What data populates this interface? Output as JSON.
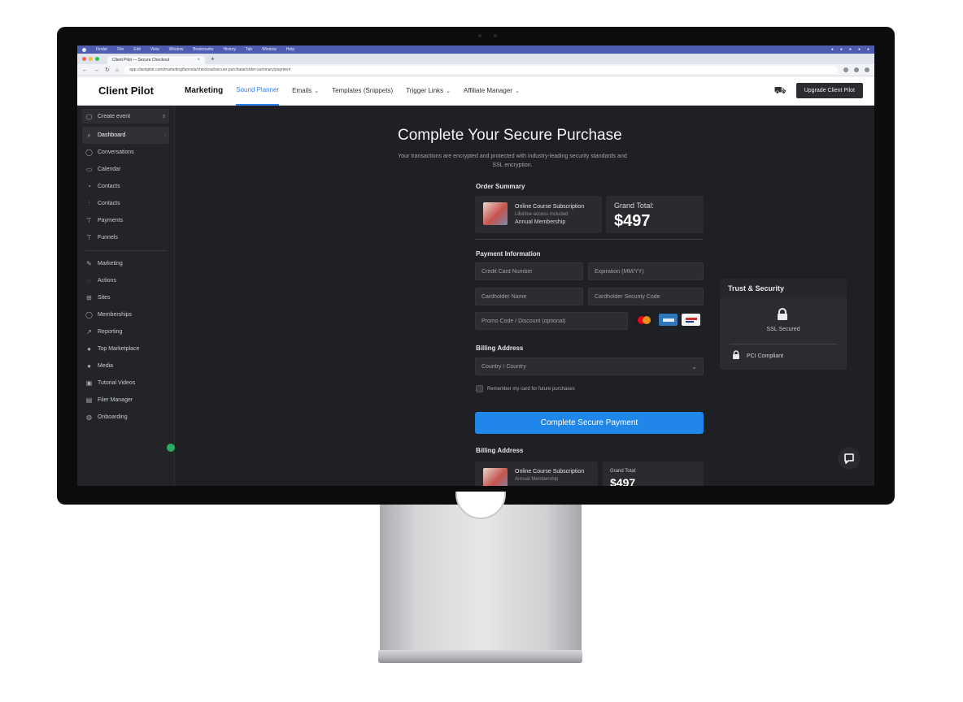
{
  "os_menu": {
    "items": [
      "Finder",
      "File",
      "Edit",
      "View",
      "Window",
      "Bookmarks",
      "History",
      "Tab",
      "Window",
      "Help"
    ]
  },
  "browser": {
    "tab_title": "Client Pilot — Secure Checkout",
    "url": "app.clientpilot.com/marketing/funnels/checkout/secure-purchase/order-summary/payment"
  },
  "app": {
    "logo": "Client Pilot",
    "nav": [
      {
        "label": "Marketing",
        "chevron": false
      },
      {
        "label": "Sound Planner",
        "chevron": false
      },
      {
        "label": "Emails",
        "chevron": true
      },
      {
        "label": "Templates (Snippets)",
        "chevron": false
      },
      {
        "label": "Trigger Links",
        "chevron": true
      },
      {
        "label": "Affiliate Manager",
        "chevron": true
      }
    ],
    "cta": "Upgrade Client Pilot"
  },
  "sidebar": {
    "switcher": "Create event",
    "items": [
      {
        "icon": "search-icon",
        "glyph": "⌕",
        "label": "Dashboard",
        "trail": "◦"
      },
      {
        "icon": "conversations-icon",
        "glyph": "◯",
        "label": "Conversations",
        "trail": ""
      },
      {
        "icon": "calendar-icon",
        "glyph": "▭",
        "label": "Calendar",
        "trail": ""
      },
      {
        "icon": "contacts-icon",
        "glyph": "◔",
        "label": "Contacts",
        "trail": ""
      },
      {
        "icon": "opportunities-icon",
        "glyph": "⫶",
        "label": "Contacts",
        "trail": ""
      },
      {
        "icon": "payments-icon",
        "glyph": "⊤",
        "label": "Payments",
        "trail": ""
      },
      {
        "icon": "forms-icon",
        "glyph": "⊤",
        "label": "Funnels",
        "trail": ""
      }
    ],
    "items2": [
      {
        "icon": "marketing-icon",
        "glyph": "✎",
        "label": "Marketing",
        "trail": ""
      },
      {
        "icon": "automation-icon",
        "glyph": "◌",
        "label": "Actions",
        "trail": ""
      },
      {
        "icon": "sites-icon",
        "glyph": "⊞",
        "label": "Sites",
        "trail": ""
      },
      {
        "icon": "memberships-icon",
        "glyph": "◯",
        "label": "Memberships",
        "trail": ""
      },
      {
        "icon": "reporting-icon",
        "glyph": "↗",
        "label": "Reporting",
        "trail": ""
      },
      {
        "icon": "marketplace-icon",
        "glyph": "●",
        "label": "Top Marketplace",
        "trail": ""
      },
      {
        "icon": "media-icon",
        "glyph": "●",
        "label": "Media",
        "trail": ""
      },
      {
        "icon": "video-icon",
        "glyph": "▣",
        "label": "Tutorial Videos",
        "trail": ""
      },
      {
        "icon": "file-manager-icon",
        "glyph": "▤",
        "label": "Filer Manager",
        "trail": ""
      },
      {
        "icon": "onboarding-icon",
        "glyph": "◍",
        "label": "Onboarding",
        "trail": ""
      }
    ]
  },
  "checkout": {
    "title": "Complete Your Secure Purchase",
    "subtitle": "Your transactions are encrypted and protected with industry-leading security standards and SSL encryption.",
    "order_summary_heading": "Order Summary",
    "product_name": "Online Course Subscription",
    "product_sub": "Lifetime access included",
    "product_plan": "Annual Membership",
    "grand_total_label": "Grand Total:",
    "grand_total": "$497",
    "payment_heading": "Payment Information",
    "fields": {
      "card_number": "Credit Card Number",
      "expiration": "Expiration (MM/YY)",
      "cardholder": "Cardholder Name",
      "cvv": "Cardholder Security Code",
      "promo": "Promo Code / Discount (optional)"
    },
    "card_brands": [
      "mastercard",
      "amex",
      "visa"
    ],
    "billing_heading": "Billing Address",
    "billing_select": "Country / Country",
    "remember": "Remember my card for future purchases",
    "pay_button": "Complete Secure Payment",
    "billing_heading_2": "Billing Address",
    "product_name_2": "Online Course Subscription",
    "product_sub_2": "Annual Membership",
    "grand_total_label_2": "Grand Total:",
    "grand_total_2": "$497"
  },
  "trust": {
    "heading": "Trust & Security",
    "ssl": "SSL Secured",
    "pci": "PCI Compliant"
  },
  "colors": {
    "accent": "#1f86ea",
    "menubar": "#4f5db0",
    "sidebar_bg": "#232427",
    "main_bg": "#1f2023"
  }
}
